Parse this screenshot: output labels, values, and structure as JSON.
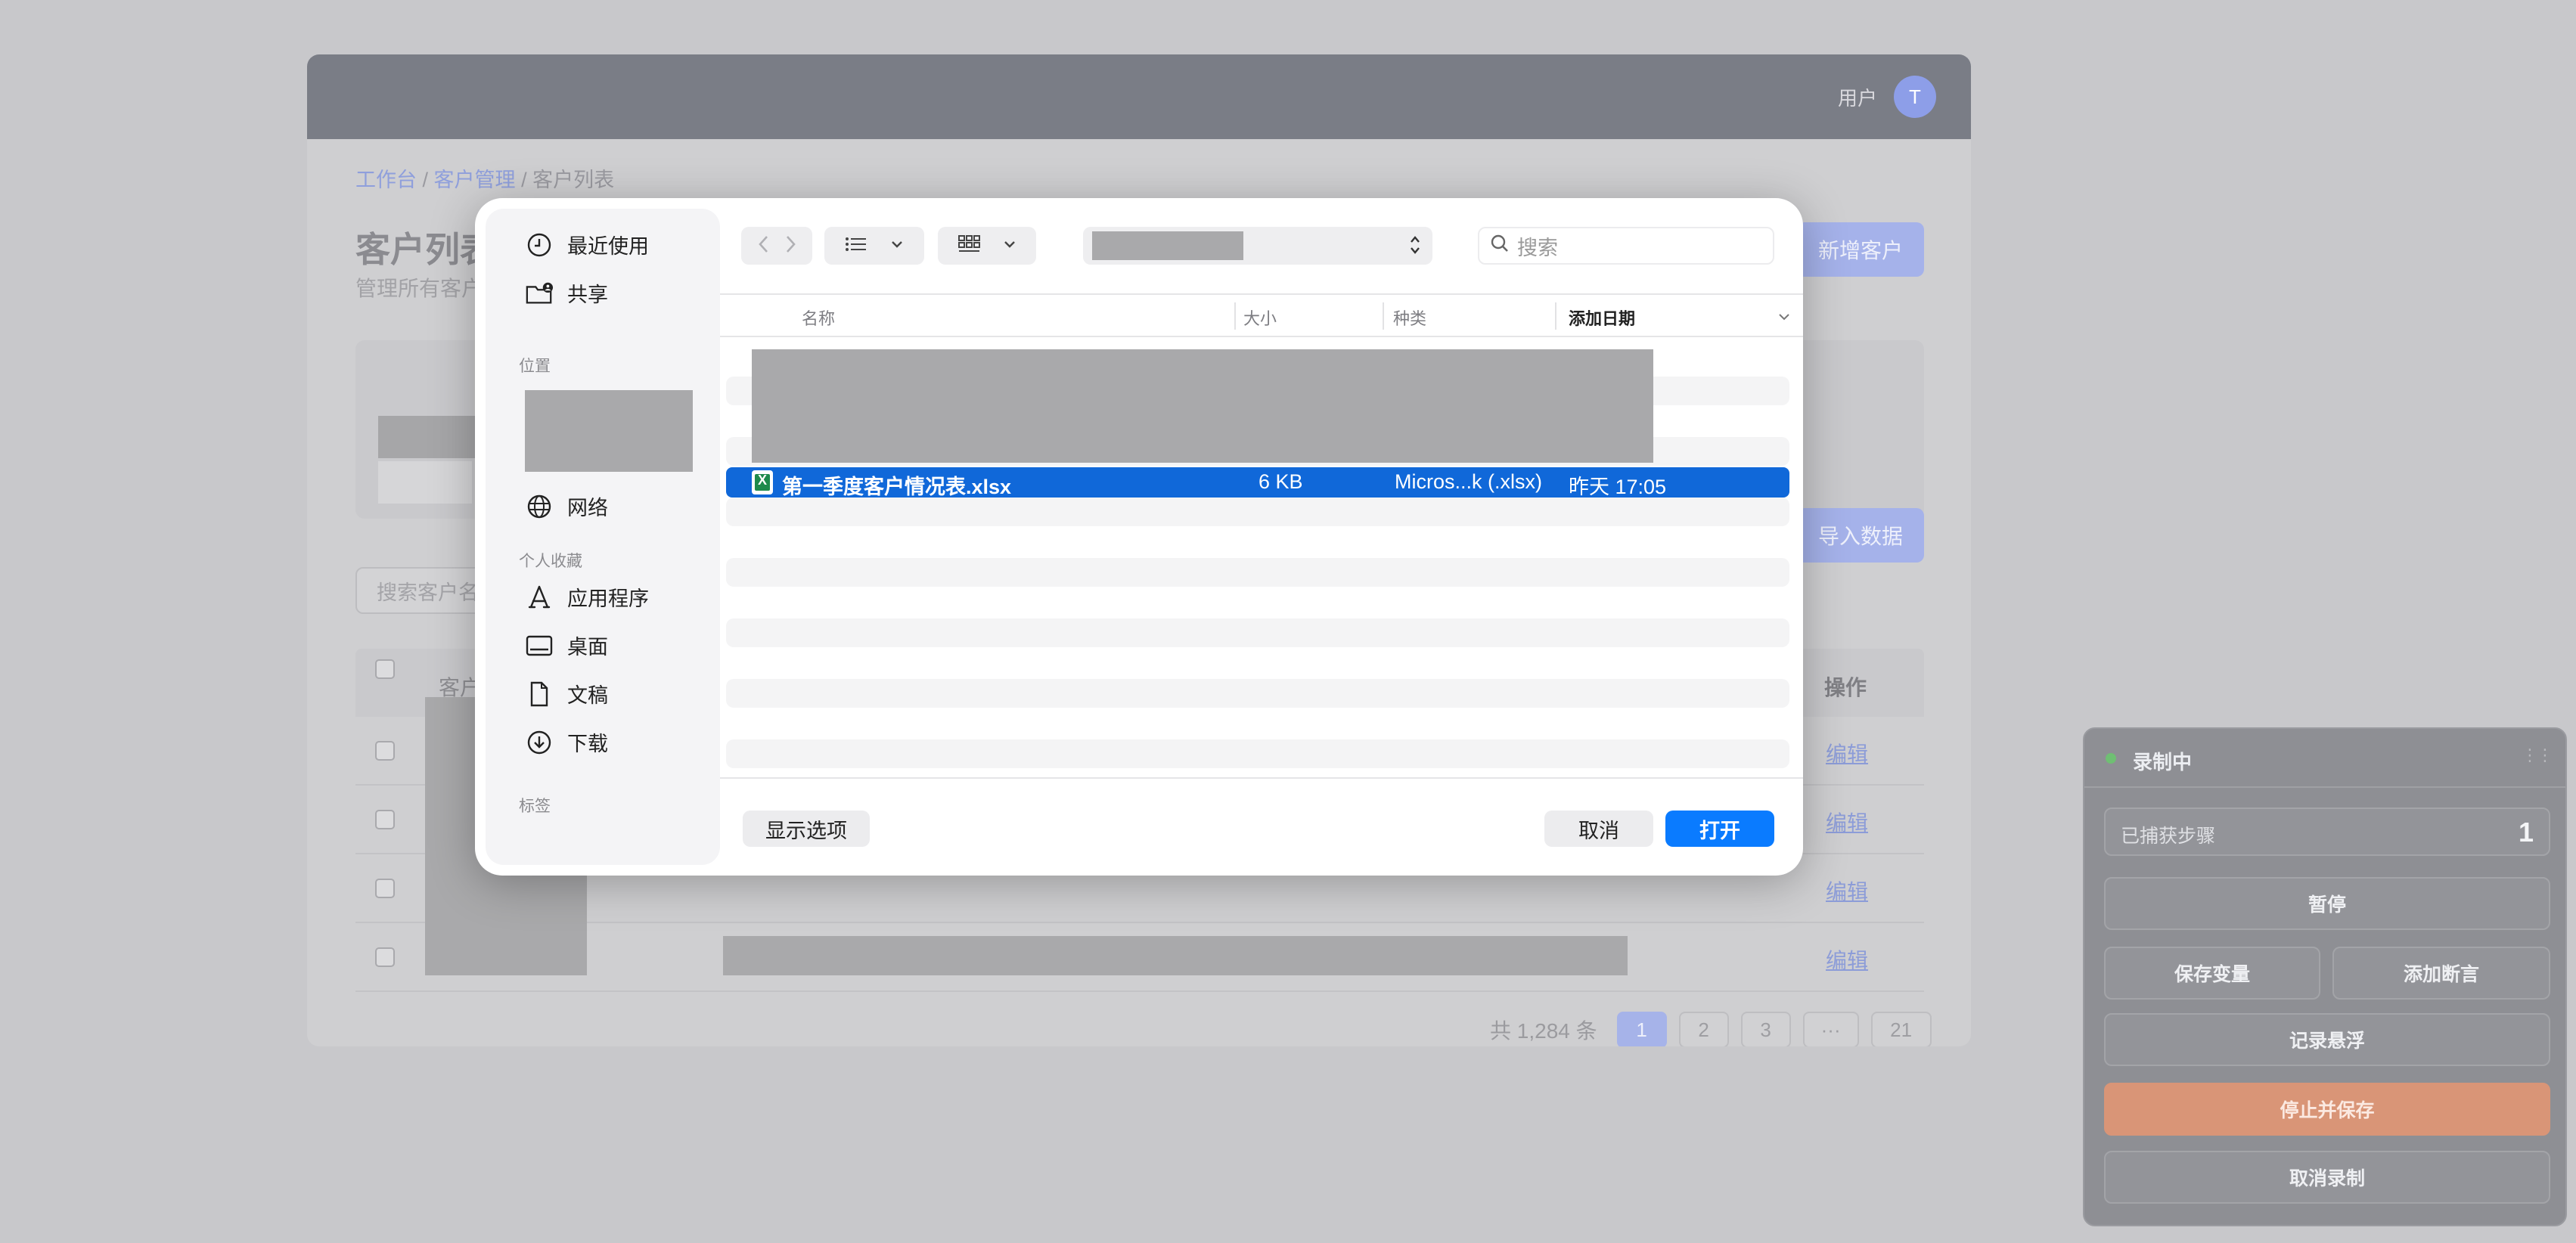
{
  "app": {
    "user_label": "用户",
    "avatar_initial": "T",
    "breadcrumb": [
      "工作台",
      "客户管理",
      "客户列表"
    ],
    "breadcrumb_sep": "/",
    "page_title": "客户列表",
    "page_subtitle": "管理所有客户",
    "add_button": "新增客户",
    "import_button": "导入数据",
    "search_placeholder": "搜索客户名",
    "table": {
      "col_customer": "客户",
      "col_action": "操作",
      "edit_label": "编辑"
    },
    "pagination": {
      "total": "共 1,284 条",
      "pages": [
        "1",
        "2",
        "3",
        "···",
        "21"
      ],
      "active": "1"
    }
  },
  "dialog": {
    "sidebar": {
      "recent": "最近使用",
      "shared": "共享",
      "section_locations": "位置",
      "network": "网络",
      "section_favorites": "个人收藏",
      "applications": "应用程序",
      "desktop": "桌面",
      "documents": "文稿",
      "downloads": "下载",
      "section_tags": "标签"
    },
    "search_placeholder": "搜索",
    "columns": {
      "name": "名称",
      "size": "大小",
      "kind": "种类",
      "date_added": "添加日期"
    },
    "selected_file": {
      "name": "第一季度客户情况表.xlsx",
      "size": "6 KB",
      "kind": "Micros...k (.xlsx)",
      "date": "昨天 17:05"
    },
    "show_options": "显示选项",
    "cancel": "取消",
    "open": "打开"
  },
  "recorder": {
    "status": "录制中",
    "steps_label": "已捕获步骤",
    "steps_count": "1",
    "pause": "暂停",
    "save_variable": "保存变量",
    "add_assertion": "添加断言",
    "record_hover": "记录悬浮",
    "stop_save": "停止并保存",
    "cancel_recording": "取消录制"
  }
}
